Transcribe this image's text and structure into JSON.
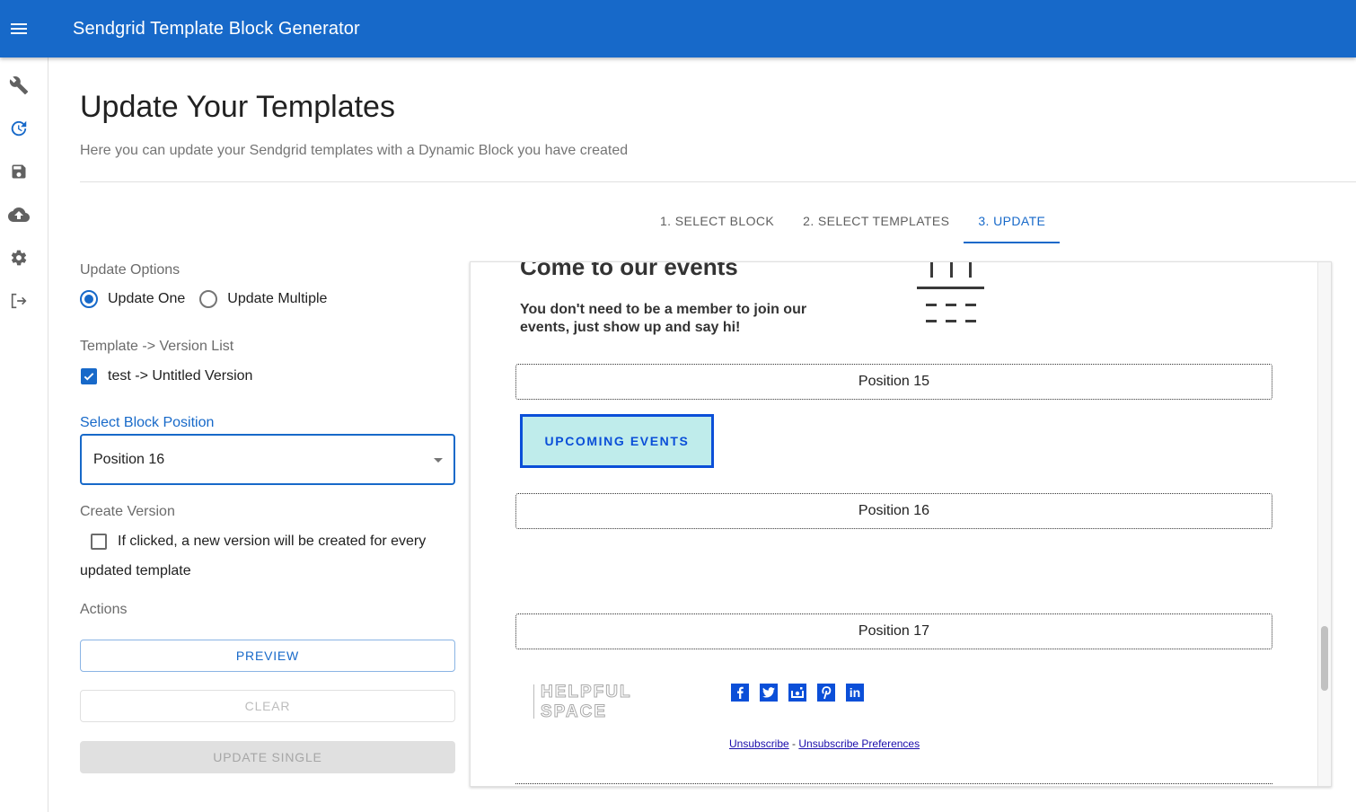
{
  "appbar": {
    "title": "Sendgrid Template Block Generator",
    "menu_icon": "hamburger-menu-icon",
    "color": "#1769c9"
  },
  "sidebar": {
    "items": [
      {
        "name": "tools",
        "icon": "wrench-icon",
        "active": false
      },
      {
        "name": "update",
        "icon": "update-clock-icon",
        "active": true
      },
      {
        "name": "save",
        "icon": "floppy-save-icon",
        "active": false
      },
      {
        "name": "upload",
        "icon": "cloud-upload-icon",
        "active": false
      },
      {
        "name": "settings",
        "icon": "gear-icon",
        "active": false
      },
      {
        "name": "logout",
        "icon": "logout-icon",
        "active": false
      }
    ]
  },
  "page": {
    "title": "Update Your Templates",
    "subtitle": "Here you can update your Sendgrid templates with a Dynamic Block you have created"
  },
  "tabs": [
    {
      "label": "1. SELECT BLOCK",
      "active": false
    },
    {
      "label": "2. SELECT TEMPLATES",
      "active": false
    },
    {
      "label": "3. UPDATE",
      "active": true
    }
  ],
  "form": {
    "update_options_label": "Update Options",
    "radio_options": [
      {
        "label": "Update One",
        "checked": true
      },
      {
        "label": "Update Multiple",
        "checked": false
      }
    ],
    "version_list_label": "Template -> Version List",
    "versions": [
      {
        "label": "test -> Untitled Version",
        "checked": true
      }
    ],
    "select_label": "Select Block Position",
    "select_value": "Position 16",
    "create_version_label": "Create Version",
    "create_version_checkbox": {
      "checked": false,
      "label_line1": "If clicked, a new version will be created for every",
      "label_line2": "updated template"
    },
    "actions_label": "Actions",
    "buttons": {
      "preview": "PREVIEW",
      "clear": "CLEAR",
      "update": "UPDATE SINGLE"
    }
  },
  "preview": {
    "event_title": "Come to our events",
    "event_text": "You don't need to be a member to join our events, just show up and say hi!",
    "positions": [
      "Position 15",
      "Position 16",
      "Position 17"
    ],
    "cta_label": "UPCOMING EVENTS",
    "logo_line1": "HELPFUL",
    "logo_line2": "SPACE",
    "socials": [
      {
        "icon": "facebook-icon",
        "glyph": "f"
      },
      {
        "icon": "twitter-icon",
        "glyph": "t"
      },
      {
        "icon": "instagram-icon",
        "glyph": "i"
      },
      {
        "icon": "pinterest-icon",
        "glyph": "p"
      },
      {
        "icon": "linkedin-icon",
        "glyph": "in"
      }
    ],
    "unsubscribe": "Unsubscribe",
    "separator": " - ",
    "unsubscribe_prefs": "Unsubscribe Preferences",
    "scroll_position_fraction": 0.72
  }
}
